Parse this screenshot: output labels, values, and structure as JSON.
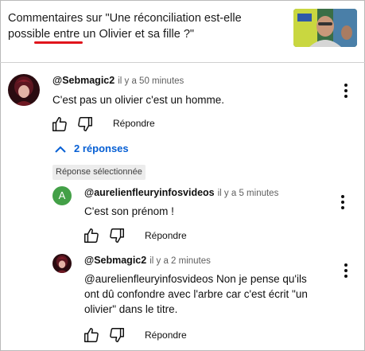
{
  "header": {
    "title": "Commentaires sur \"Une réconciliation est-elle possible entre un Olivier et sa fille ?\""
  },
  "comments": [
    {
      "author": "@Sebmagic2",
      "time": "il y a 50 minutes",
      "text": "C'est pas un olivier c'est un homme.",
      "reply_label": "Répondre"
    }
  ],
  "replies_toggle": {
    "label": "2 réponses"
  },
  "selected_badge": "Réponse sélectionnée",
  "replies": [
    {
      "avatar_letter": "A",
      "author": "@aurelienfleuryinfosvideos",
      "time": "il y a 5 minutes",
      "text": "C'est son prénom !",
      "reply_label": "Répondre"
    },
    {
      "author": "@Sebmagic2",
      "time": "il y a 2 minutes",
      "text_line1": "@aurelienfleuryinfosvideos  Non je pense qu'ils",
      "text_line2": "ont dû confondre avec l'arbre car c'est écrit \"un",
      "text_line3": "olivier\" dans le titre.",
      "reply_label": "Répondre"
    }
  ],
  "colors": {
    "link_blue": "#065fd4",
    "underline_red": "#e0141c",
    "avatar_green": "#43a047"
  }
}
